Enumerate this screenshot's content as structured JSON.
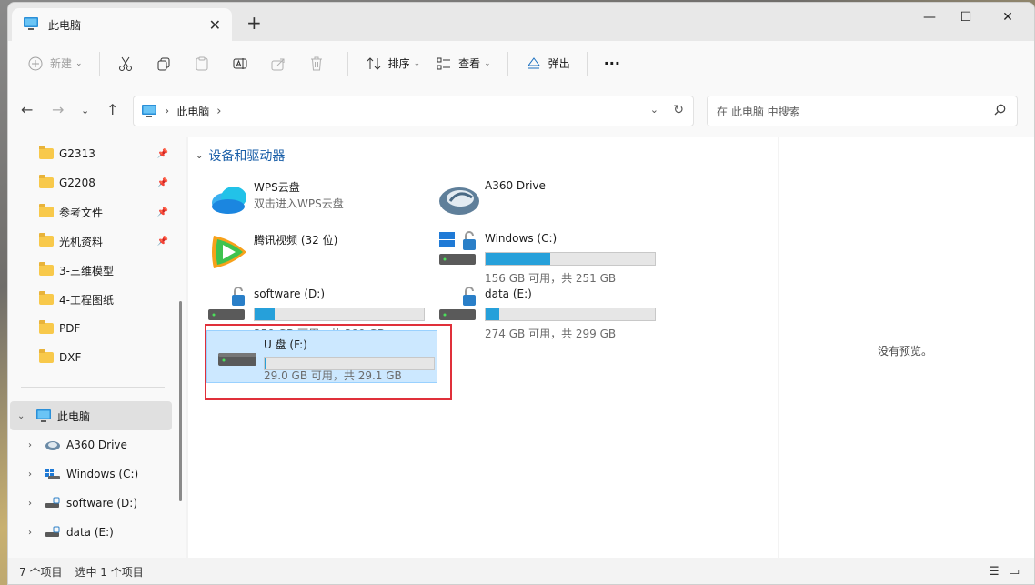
{
  "window": {
    "tab_title": "此电脑",
    "new_tab": "+",
    "close_tab": "✕",
    "minimize": "—",
    "maximize": "☐",
    "close": "✕"
  },
  "toolbar": {
    "new_label": "新建",
    "sort_label": "排序",
    "view_label": "查看",
    "eject_label": "弹出",
    "more_label": "···",
    "icons": [
      "plus-icon",
      "cut-icon",
      "copy-icon",
      "paste-icon",
      "rename-icon",
      "share-icon",
      "delete-icon",
      "sort-icon",
      "view-icon",
      "eject-icon",
      "more-icon"
    ]
  },
  "address": {
    "location": "此电脑",
    "search_placeholder": "在 此电脑 中搜索"
  },
  "sidebar": {
    "quick_access": [
      {
        "label": "G2313",
        "pinned": true
      },
      {
        "label": "G2208",
        "pinned": true
      },
      {
        "label": "参考文件",
        "pinned": true
      },
      {
        "label": "光机资料",
        "pinned": true
      },
      {
        "label": "3-三维模型",
        "pinned": false
      },
      {
        "label": "4-工程图纸",
        "pinned": false
      },
      {
        "label": "PDF",
        "pinned": false
      },
      {
        "label": "DXF",
        "pinned": false
      }
    ],
    "this_pc": "此电脑",
    "drives": [
      {
        "label": "A360 Drive",
        "icon": "a360-icon"
      },
      {
        "label": "Windows (C:)",
        "icon": "windows-drive-icon"
      },
      {
        "label": "software (D:)",
        "icon": "drive-icon"
      },
      {
        "label": "data (E:)",
        "icon": "drive-icon"
      }
    ]
  },
  "content": {
    "group_title": "设备和驱动器",
    "tiles": [
      {
        "name": "WPS云盘",
        "sub": "双击进入WPS云盘",
        "icon": "wps-cloud-icon"
      },
      {
        "name": "A360 Drive",
        "icon": "a360-icon"
      },
      {
        "name": "腾讯视频 (32 位)",
        "icon": "tencent-video-icon"
      },
      {
        "name": "Windows (C:)",
        "sub": "156 GB 可用，共 251 GB",
        "used_fraction": 0.38,
        "icon": "windows-drive-icon"
      },
      {
        "name": "software (D:)",
        "sub": "350 GB 可用，共 399 GB",
        "used_fraction": 0.12,
        "icon": "drive-icon"
      },
      {
        "name": "data (E:)",
        "sub": "274 GB 可用，共 299 GB",
        "used_fraction": 0.08,
        "icon": "drive-icon"
      },
      {
        "name": "U 盘 (F:)",
        "sub": "29.0 GB 可用，共 29.1 GB",
        "used_fraction": 0.003,
        "icon": "usb-drive-icon"
      }
    ]
  },
  "preview": {
    "message": "没有预览。"
  },
  "status": {
    "item_count": "7 个项目",
    "selected": "选中 1 个项目"
  },
  "colors": {
    "accent": "#26a0da",
    "selection": "#cce8ff",
    "highlight_box": "#e0303a",
    "group_header": "#1a5fa8"
  }
}
